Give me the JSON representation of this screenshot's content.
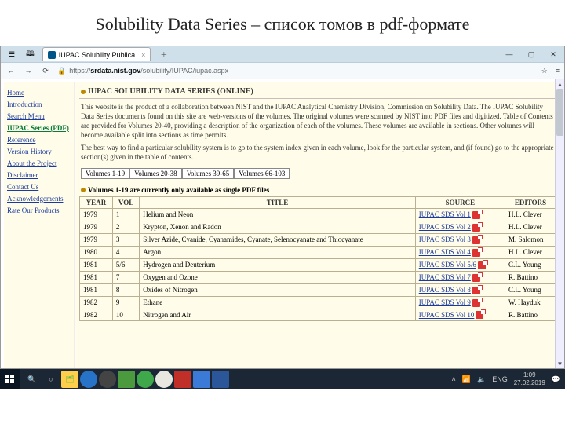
{
  "slide": {
    "title": "Solubility Data Series – список томов в pdf-формате"
  },
  "browser": {
    "tab_title": "IUPAC Solubility Publica",
    "url_prefix": "https://",
    "url_host": "srdata.nist.gov",
    "url_path": "/solubility/IUPAC/iupac.aspx",
    "nav": {
      "back": "←",
      "fwd": "→",
      "reload": "⟳"
    },
    "win": {
      "min": "—",
      "max": "▢",
      "close": "✕"
    },
    "right_icons": {
      "star": "☆",
      "menu": "≡"
    }
  },
  "sidebar": {
    "items": [
      "Home",
      "Introduction",
      "Search Menu",
      "IUPAC Series (PDF)",
      "Reference",
      "Version History",
      "About the Project",
      "Disclaimer",
      "Contact Us",
      "Acknowledgements",
      "Rate Our Products"
    ],
    "active_index": 3
  },
  "page": {
    "title": "IUPAC SOLUBILITY DATA SERIES (ONLINE)",
    "intro": [
      "This website is the product of a collaboration between NIST and the IUPAC Analytical Chemistry Division, Commission on Solubility Data. The IUPAC Solubility Data Series documents found on this site are web-versions of the volumes. The original volumes were scanned by NIST into PDF files and digitized. Table of Contents are provided for Volumes 20-40, providing a description of the organization of each of the volumes. These volumes are available in sections. Other volumes will become available split into sections as time permits.",
      "The best way to find a particular solubility system is to go to the system index given in each volume, look for the particular system, and (if found) go to the appropriate section(s) given in the table of contents."
    ],
    "vol_tabs": [
      "Volumes 1-19",
      "Volumes 20-38",
      "Volumes 39-65",
      "Volumes 66-103"
    ],
    "table_note": "Volumes 1-19 are currently only available as single PDF files",
    "columns": [
      "YEAR",
      "VOL",
      "TITLE",
      "SOURCE",
      "EDITORS"
    ],
    "rows": [
      {
        "year": "1979",
        "vol": "1",
        "title": "Helium and Neon",
        "source": "IUPAC SDS Vol 1",
        "editors": "H.L. Clever"
      },
      {
        "year": "1979",
        "vol": "2",
        "title": "Krypton, Xenon and Radon",
        "source": "IUPAC SDS Vol 2",
        "editors": "H.L. Clever"
      },
      {
        "year": "1979",
        "vol": "3",
        "title": "Silver Azide, Cyanide, Cyanamides, Cyanate, Selenocyanate and Thiocyanate",
        "source": "IUPAC SDS Vol 3",
        "editors": "M. Salomon"
      },
      {
        "year": "1980",
        "vol": "4",
        "title": "Argon",
        "source": "IUPAC SDS Vol 4",
        "editors": "H.L. Clever"
      },
      {
        "year": "1981",
        "vol": "5/6",
        "title": "Hydrogen and Deuterium",
        "source": "IUPAC SDS Vol 5/6",
        "editors": "C.L. Young"
      },
      {
        "year": "1981",
        "vol": "7",
        "title": "Oxygen and Ozone",
        "source": "IUPAC SDS Vol 7",
        "editors": "R. Battino"
      },
      {
        "year": "1981",
        "vol": "8",
        "title": "Oxides of Nitrogen",
        "source": "IUPAC SDS Vol 8",
        "editors": "C.L. Young"
      },
      {
        "year": "1982",
        "vol": "9",
        "title": "Ethane",
        "source": "IUPAC SDS Vol 9",
        "editors": "W. Hayduk"
      },
      {
        "year": "1982",
        "vol": "10",
        "title": "Nitrogen and Air",
        "source": "IUPAC SDS Vol 10",
        "editors": "R. Battino"
      }
    ]
  },
  "taskbar": {
    "tray": {
      "wifi": "📶",
      "vol": "🔈",
      "lang": "ENG",
      "time": "1:09",
      "date": "27.02.2019",
      "notif": "💬"
    }
  }
}
